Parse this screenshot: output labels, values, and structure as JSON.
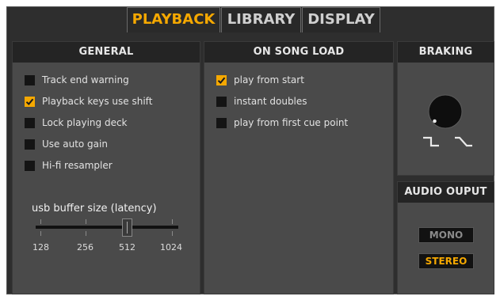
{
  "tabs": [
    {
      "label": "PLAYBACK",
      "active": true
    },
    {
      "label": "LIBRARY",
      "active": false
    },
    {
      "label": "DISPLAY",
      "active": false
    }
  ],
  "general": {
    "title": "GENERAL",
    "options": [
      {
        "label": "Track end warning",
        "checked": false
      },
      {
        "label": "Playback keys use shift",
        "checked": true
      },
      {
        "label": "Lock playing deck",
        "checked": false
      },
      {
        "label": "Use auto gain",
        "checked": false
      },
      {
        "label": "Hi-fi resampler",
        "checked": false
      }
    ],
    "buffer": {
      "title": "usb buffer size (latency)",
      "ticks": [
        "128",
        "256",
        "512",
        "1024"
      ],
      "selected": "512"
    }
  },
  "song_load": {
    "title": "ON SONG LOAD",
    "options": [
      {
        "label": "play from start",
        "checked": true
      },
      {
        "label": "instant doubles",
        "checked": false
      },
      {
        "label": "play from first cue point",
        "checked": false
      }
    ]
  },
  "braking": {
    "title": "BRAKING",
    "knob_icon": "knob-icon",
    "curve_icons": [
      "step-curve-icon",
      "ramp-curve-icon"
    ]
  },
  "audio_output": {
    "title": "AUDIO OUPUT",
    "options": [
      {
        "label": "MONO",
        "selected": false
      },
      {
        "label": "STEREO",
        "selected": true
      }
    ]
  },
  "colors": {
    "accent": "#f5a800",
    "panel": "#4a4a4a",
    "header": "#242424",
    "frame": "#2e2e2e"
  }
}
